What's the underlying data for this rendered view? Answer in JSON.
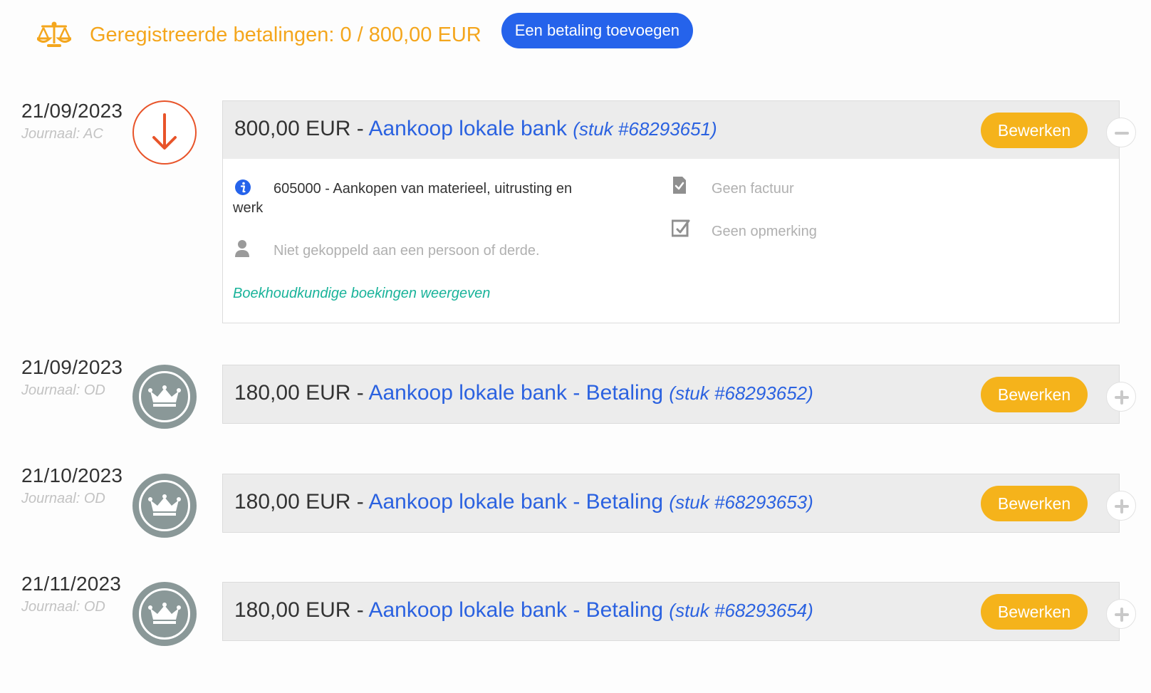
{
  "header": {
    "summary": "Geregistreerde betalingen: 0 / 800,00 EUR",
    "add_button": "Een betaling toevoegen",
    "icon": "scale-icon"
  },
  "entries": [
    {
      "date": "21/09/2023",
      "journal": "Journaal: AC",
      "type_icon": "arrow-down-icon",
      "amount": "800,00 EUR",
      "separator": " - ",
      "title": "Aankoop lokale bank",
      "reference": "(stuk #68293651)",
      "edit_label": "Bewerken",
      "toggle_icon": "minus-icon",
      "expanded": true
    },
    {
      "date": "21/09/2023",
      "journal": "Journaal: OD",
      "type_icon": "crown-icon",
      "amount": "180,00 EUR",
      "separator": " - ",
      "title": "Aankoop lokale bank - Betaling",
      "reference": "(stuk #68293652)",
      "edit_label": "Bewerken",
      "toggle_icon": "plus-icon",
      "expanded": false
    },
    {
      "date": "21/10/2023",
      "journal": "Journaal: OD",
      "type_icon": "crown-icon",
      "amount": "180,00 EUR",
      "separator": " - ",
      "title": "Aankoop lokale bank - Betaling",
      "reference": "(stuk #68293653)",
      "edit_label": "Bewerken",
      "toggle_icon": "plus-icon",
      "expanded": false
    },
    {
      "date": "21/11/2023",
      "journal": "Journaal: OD",
      "type_icon": "crown-icon",
      "amount": "180,00 EUR",
      "separator": " - ",
      "title": "Aankoop lokale bank - Betaling",
      "reference": "(stuk #68293654)",
      "edit_label": "Bewerken",
      "toggle_icon": "plus-icon",
      "expanded": false
    }
  ],
  "detail": {
    "account_line1": "605000 - Aankopen van materieel, uitrusting en",
    "account_line2": "werk",
    "person": "Niet gekoppeld aan een persoon of derde.",
    "invoice": "Geen factuur",
    "remark": "Geen opmerking",
    "show_entries_link": "Boekhoudkundige boekingen weergeven"
  },
  "colors": {
    "accent_orange": "#f4a61d",
    "primary_blue": "#2563eb",
    "link_blue": "#2b62e0",
    "edit_yellow": "#f5b31b",
    "teal_link": "#19b39a",
    "down_arrow": "#e8542a",
    "crown_grey": "#8a9898"
  }
}
